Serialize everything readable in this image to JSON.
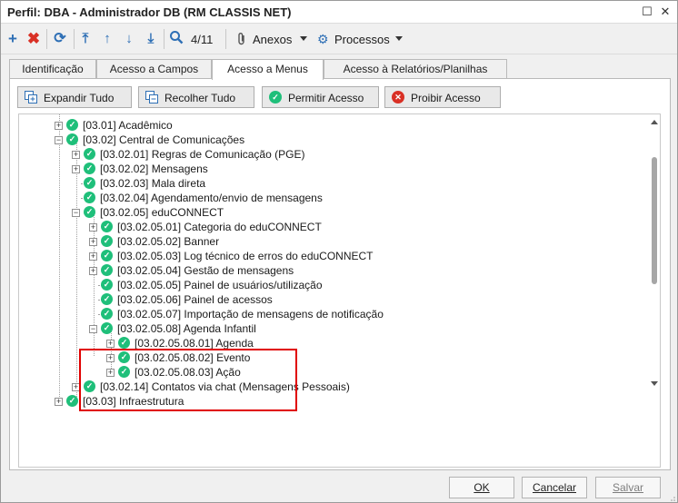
{
  "window": {
    "title": "Perfil: DBA - Administrador DB (RM CLASSIS NET)"
  },
  "toolbar": {
    "record_counter": "4/11",
    "attachments_label": "Anexos",
    "processes_label": "Processos"
  },
  "tabs": [
    {
      "label": "Identificação"
    },
    {
      "label": "Acesso a Campos"
    },
    {
      "label": "Acesso a Menus"
    },
    {
      "label": "Acesso à Relatórios/Planilhas"
    }
  ],
  "actions": {
    "expand_all": "Expandir Tudo",
    "collapse_all": "Recolher Tudo",
    "allow_access": "Permitir Acesso",
    "deny_access": "Proibir Acesso"
  },
  "tree": {
    "nodes": [
      {
        "label": "[03.01] Acadêmico",
        "expander": "+"
      },
      {
        "label": "[03.02] Central de Comunicações",
        "expander": "-"
      },
      {
        "label": "[03.02.01] Regras de Comunicação (PGE)",
        "expander": "+"
      },
      {
        "label": "[03.02.02] Mensagens",
        "expander": "+"
      },
      {
        "label": "[03.02.03] Mala direta",
        "expander": ""
      },
      {
        "label": "[03.02.04] Agendamento/envio de mensagens",
        "expander": ""
      },
      {
        "label": "[03.02.05] eduCONNECT",
        "expander": "-"
      },
      {
        "label": "[03.02.05.01] Categoria do eduCONNECT",
        "expander": "+"
      },
      {
        "label": "[03.02.05.02] Banner",
        "expander": "+"
      },
      {
        "label": "[03.02.05.03] Log técnico de erros do eduCONNECT",
        "expander": "+"
      },
      {
        "label": "[03.02.05.04] Gestão de mensagens",
        "expander": "+"
      },
      {
        "label": "[03.02.05.05] Painel de usuários/utilização",
        "expander": ""
      },
      {
        "label": "[03.02.05.06] Painel de acessos",
        "expander": ""
      },
      {
        "label": "[03.02.05.07] Importação de mensagens de notificação",
        "expander": ""
      },
      {
        "label": "[03.02.05.08] Agenda Infantil",
        "expander": "-"
      },
      {
        "label": "[03.02.05.08.01] Agenda",
        "expander": "+"
      },
      {
        "label": "[03.02.05.08.02] Evento",
        "expander": "+"
      },
      {
        "label": "[03.02.05.08.03] Ação",
        "expander": "+"
      },
      {
        "label": "[03.02.14] Contatos via chat (Mensagens Pessoais)",
        "expander": "+"
      },
      {
        "label": "[03.03] Infraestrutura",
        "expander": "+"
      }
    ]
  },
  "footer": {
    "ok": "OK",
    "cancel": "Cancelar",
    "save": "Salvar"
  },
  "colors": {
    "check_green": "#1fbf7a",
    "highlight_red": "#e00000",
    "icon_blue": "#2e6fb5",
    "delete_red": "#d93025"
  }
}
